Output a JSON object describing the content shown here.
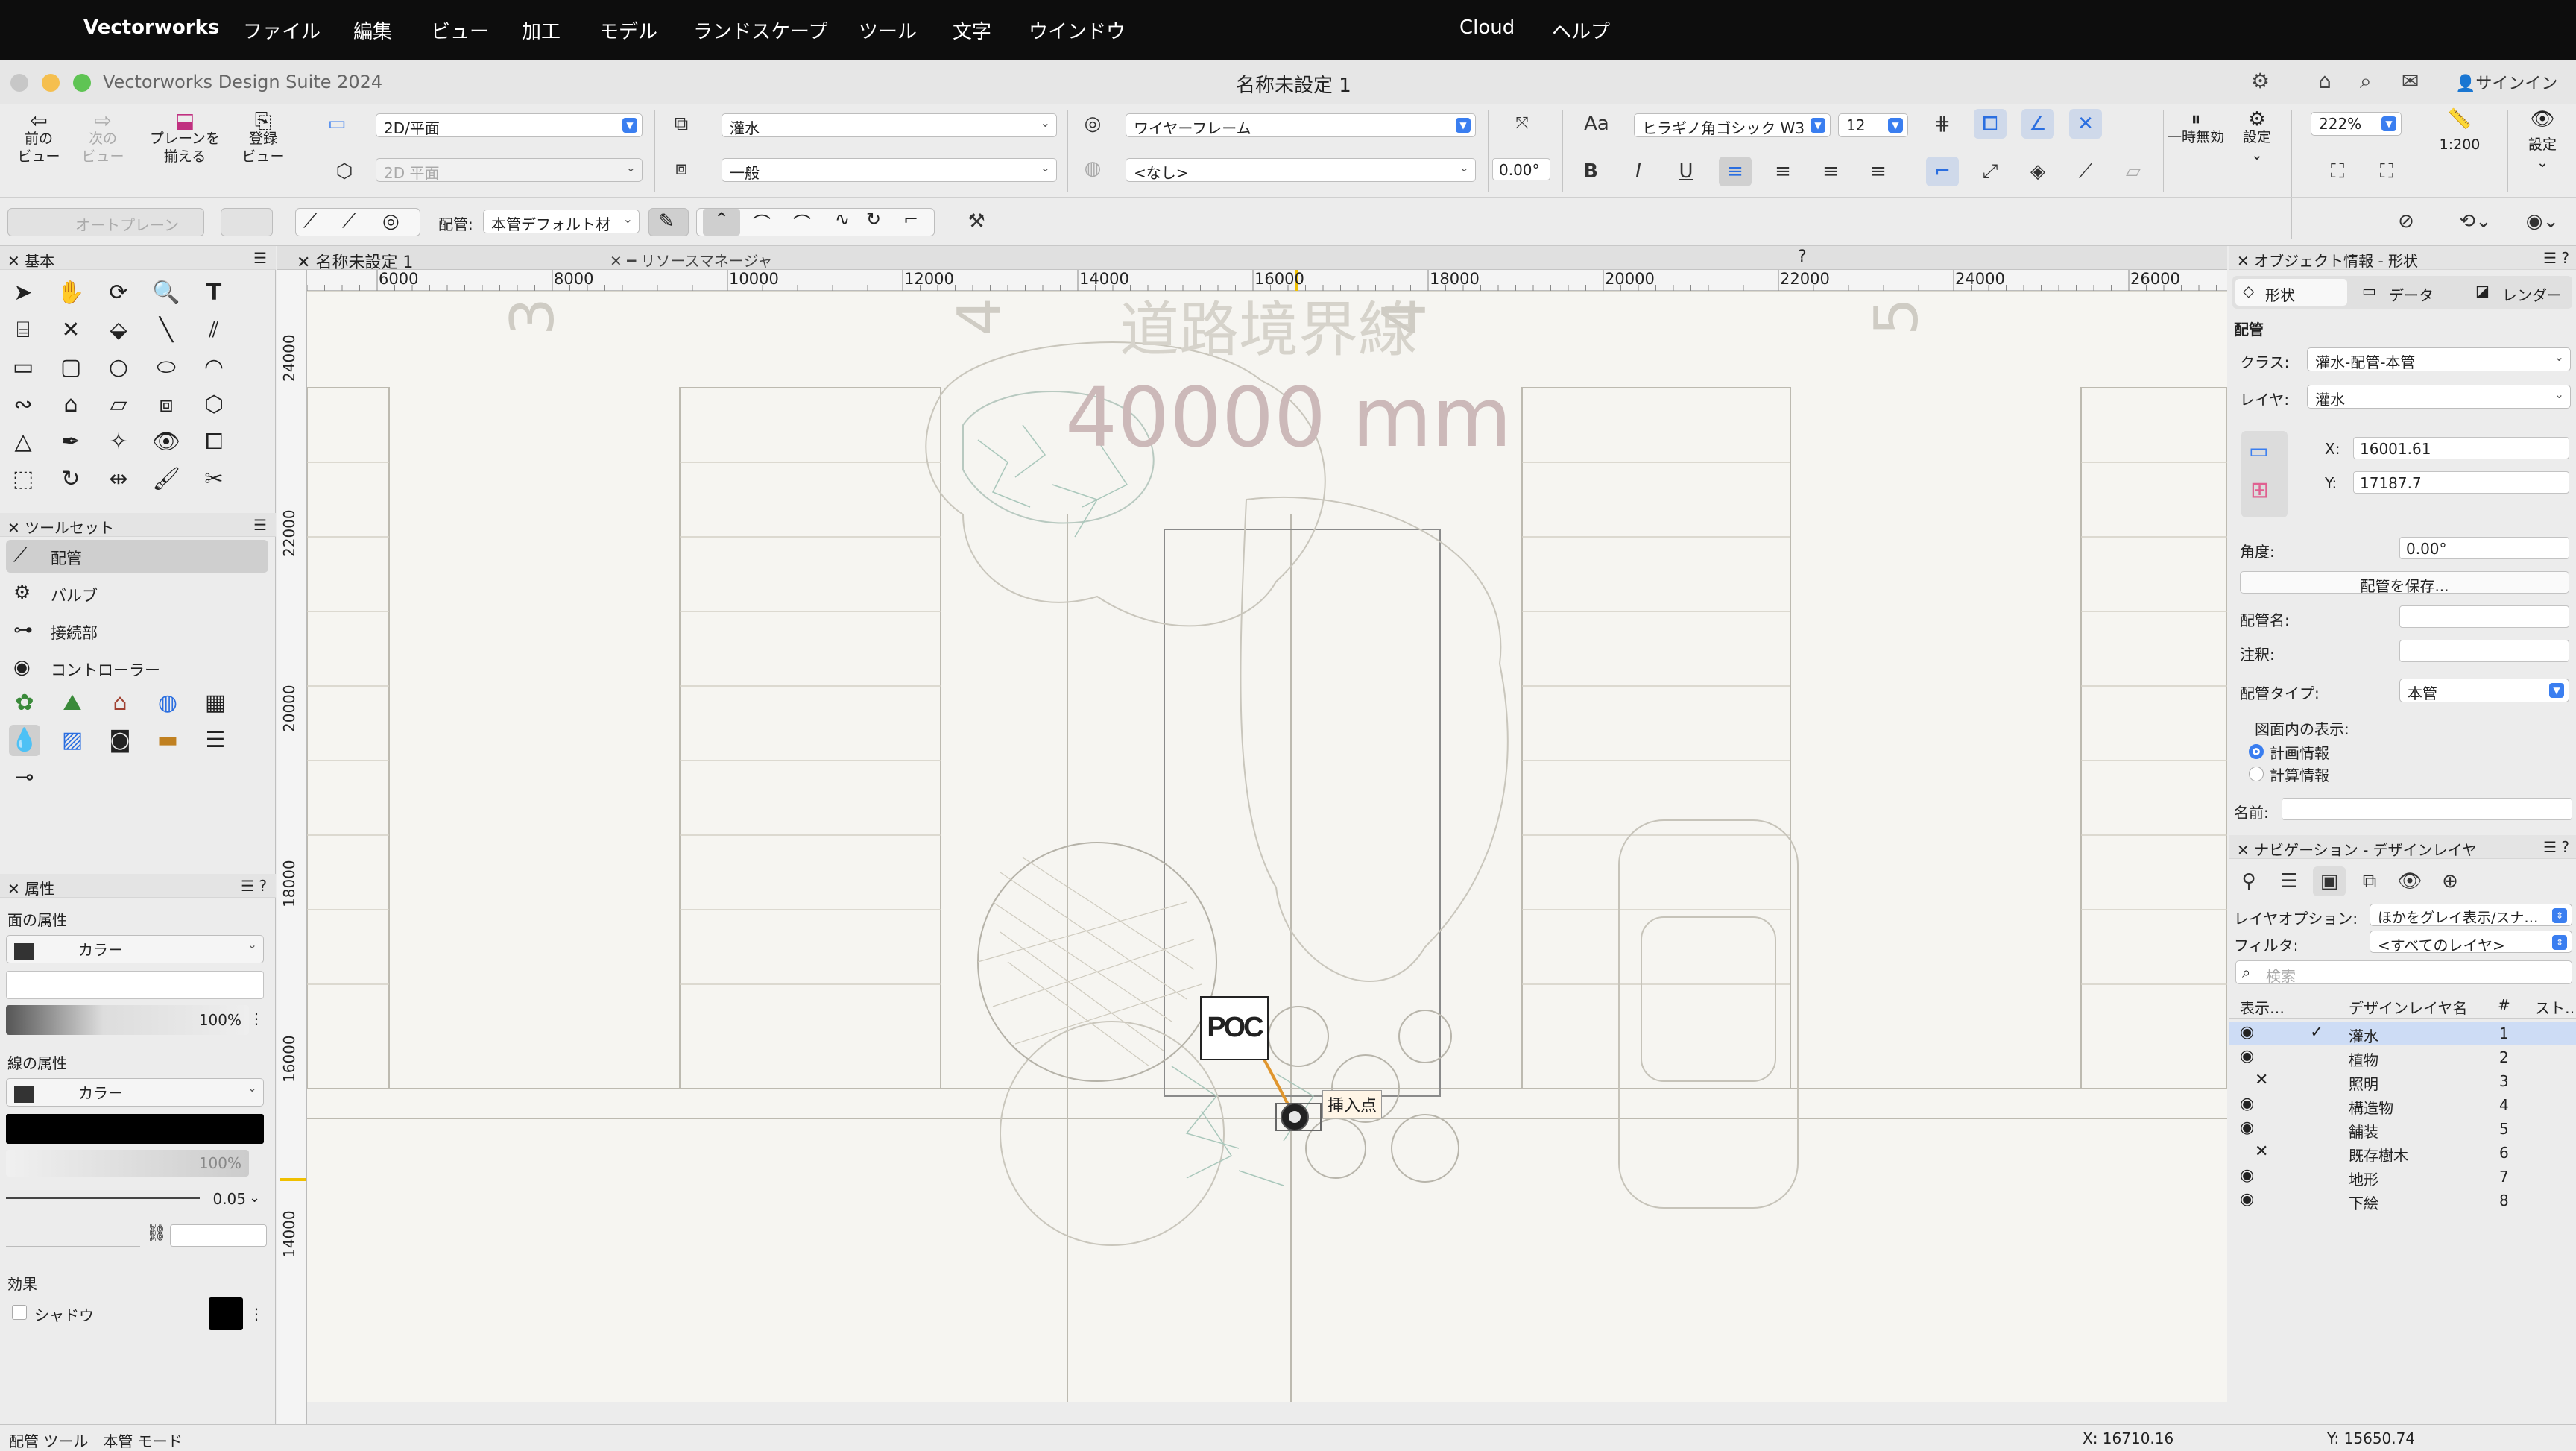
{
  "menubar": {
    "app": "Vectorworks",
    "items": [
      "ファイル",
      "編集",
      "ビュー",
      "加工",
      "モデル",
      "ランドスケープ",
      "ツール",
      "文字",
      "ウインドウ"
    ],
    "cloud": "Cloud",
    "help": "ヘルプ"
  },
  "window": {
    "app_title": "Vectorworks Design Suite 2024",
    "doc_title": "名称未設定 1",
    "signin": "サインイン"
  },
  "toolbar": {
    "prev_view": "前の\nビュー",
    "next_view": "次の\nビュー",
    "align_plane": "プレーンを\n揃える",
    "register_view": "登録\nビュー",
    "view_select": "2D/平面",
    "plane_select": "2D 平面",
    "class_select": "灌水",
    "layer_select": "一般",
    "render_select": "ワイヤーフレーム",
    "sub_select": "<なし>",
    "angle": "0.00°",
    "font": "ヒラギノ角ゴシック W3",
    "font_size": "12",
    "pause_label": "一時無効",
    "settings_label": "設定",
    "zoom": "222%",
    "scale": "1:200",
    "view_settings": "設定",
    "auto_plane": "オートプレーン",
    "pipe_label": "配管:",
    "pipe_select": "本管デフォルト材"
  },
  "left": {
    "basic_title": "基本",
    "toolset_title": "ツールセット",
    "toolset_items": [
      "配管",
      "バルブ",
      "接続部",
      "コントローラー"
    ],
    "attr_title": "属性",
    "fill_attr": "面の属性",
    "fill_color": "カラー",
    "opacity": "100%",
    "line_attr": "線の属性",
    "line_color": "カラー",
    "line_opacity": "100%",
    "line_weight": "0.05",
    "effects": "効果",
    "shadow": "シャドウ"
  },
  "canvas": {
    "tab_doc": "名称未設定 1",
    "tab_resource": "リソースマネージャ",
    "hruler": [
      "6000",
      "8000",
      "10000",
      "12000",
      "14000",
      "16000",
      "18000",
      "20000",
      "22000",
      "24000",
      "26000"
    ],
    "vruler": [
      "24000",
      "22000",
      "20000",
      "18000",
      "16000",
      "14000"
    ],
    "dim_text": "40000 mm",
    "road_text": "道路境界線",
    "poc_label": "POC",
    "insert_label": "挿入点"
  },
  "objinfo": {
    "title": "オブジェクト情報 - 形状",
    "tabs": [
      "形状",
      "データ",
      "レンダー"
    ],
    "section": "配管",
    "class_label": "クラス:",
    "class_value": "灌水-配管-本管",
    "layer_label": "レイヤ:",
    "layer_value": "灌水",
    "x_label": "X:",
    "x_value": "16001.61",
    "y_label": "Y:",
    "y_value": "17187.7",
    "angle_label": "角度:",
    "angle_value": "0.00°",
    "save_button": "配管を保存...",
    "name_label": "配管名:",
    "note_label": "注釈:",
    "type_label": "配管タイプ:",
    "type_value": "本管",
    "display_label": "図面内の表示:",
    "radio1": "計画情報",
    "radio2": "計算情報",
    "name2_label": "名前:"
  },
  "nav": {
    "title": "ナビゲーション - デザインレイヤ",
    "layer_opt_label": "レイヤオプション:",
    "layer_opt_value": "ほかをグレイ表示/スナ…",
    "filter_label": "フィルタ:",
    "filter_value": "<すべてのレイヤ>",
    "search_placeholder": "検索",
    "col_vis": "表示…",
    "col_name": "デザインレイヤ名",
    "col_num": "#",
    "col_st": "スト…",
    "layers": [
      {
        "name": "灌水",
        "num": "1",
        "vis": "eye",
        "active": true
      },
      {
        "name": "植物",
        "num": "2",
        "vis": "eye"
      },
      {
        "name": "照明",
        "num": "3",
        "vis": "x"
      },
      {
        "name": "構造物",
        "num": "4",
        "vis": "eye"
      },
      {
        "name": "舗装",
        "num": "5",
        "vis": "eye"
      },
      {
        "name": "既存樹木",
        "num": "6",
        "vis": "x"
      },
      {
        "name": "地形",
        "num": "7",
        "vis": "eye"
      },
      {
        "name": "下絵",
        "num": "8",
        "vis": "eye"
      }
    ]
  },
  "status": {
    "left": "配管 ツール　本管 モード",
    "x": "X: 16710.16",
    "y": "Y: 15650.74"
  },
  "colors": {
    "accent": "#3a7ef0",
    "menubar": "#0d0d0d",
    "canvas_bg": "#f6f5f1",
    "pipe": "#e0962e"
  }
}
